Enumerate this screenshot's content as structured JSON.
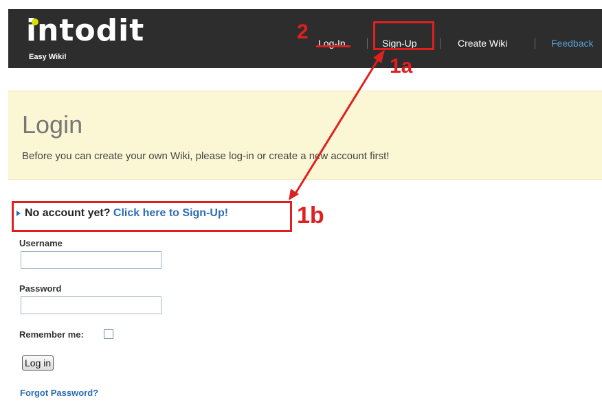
{
  "header": {
    "logo_text": "intodit",
    "logo_sub": "Easy Wiki!",
    "nav": {
      "login": "Log-In",
      "signup": "Sign-Up",
      "create_wiki": "Create Wiki",
      "feedback": "Feedback"
    }
  },
  "banner": {
    "title": "Login",
    "subtitle": "Before you can create your own Wiki, please log-in or create a new account first!"
  },
  "signup_prompt": {
    "text": "No account yet?",
    "link": "Click here to Sign-Up!"
  },
  "form": {
    "username_label": "Username",
    "username_value": "",
    "password_label": "Password",
    "password_value": "",
    "remember_label": "Remember me:",
    "remember_checked": false,
    "login_button": "Log in",
    "forgot_link": "Forgot Password?"
  },
  "annotations": {
    "label_2": "2",
    "label_1a": "1a",
    "label_1b": "1b",
    "color": "#e02020"
  }
}
